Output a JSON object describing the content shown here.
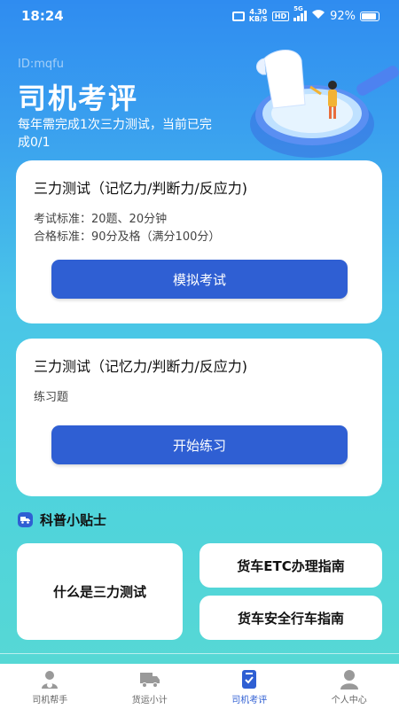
{
  "status_bar": {
    "time": "18:24",
    "speed": "4.30",
    "speed_unit": "KB/S",
    "hd": "HD",
    "network": "5G",
    "battery": "92%"
  },
  "header": {
    "user_id": "ID:mqfu",
    "title": "司机考评",
    "subtitle": "每年需完成1次三力测试，当前已完成0/1"
  },
  "cards": [
    {
      "title": "三力测试（记忆力/判断力/反应力)",
      "lines": [
        "考试标准：20题、20分钟",
        "合格标准：90分及格（满分100分）"
      ],
      "button": "模拟考试"
    },
    {
      "title": "三力测试（记忆力/判断力/反应力)",
      "lines": [
        "练习题"
      ],
      "button": "开始练习"
    }
  ],
  "tips": {
    "heading": "科普小贴士",
    "items": [
      "什么是三力测试",
      "货车ETC办理指南",
      "货车安全行车指南"
    ]
  },
  "tabbar": [
    {
      "label": "司机帮手",
      "icon": "driver-icon"
    },
    {
      "label": "货运小计",
      "icon": "truck-icon"
    },
    {
      "label": "司机考评",
      "icon": "clipboard-check-icon",
      "active": true
    },
    {
      "label": "个人中心",
      "icon": "person-icon"
    }
  ],
  "colors": {
    "accent": "#2f5fd3",
    "gradient_top": "#2f8cf0",
    "gradient_bottom": "#58d9d3"
  }
}
